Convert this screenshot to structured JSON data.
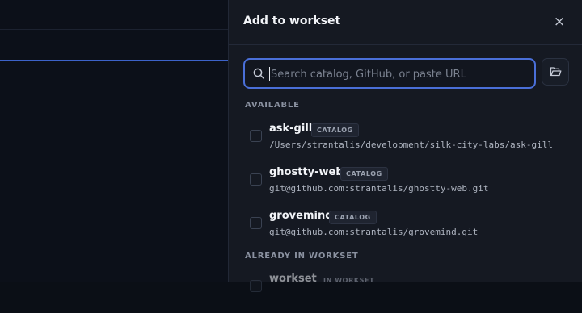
{
  "panel": {
    "title": "Add to workset",
    "close_label": "×"
  },
  "search": {
    "placeholder": "Search catalog, GitHub, or paste URL",
    "value": ""
  },
  "sections": {
    "available": "AVAILABLE",
    "already": "ALREADY IN WORKSET"
  },
  "available_items": [
    {
      "name": "ask-gill",
      "badge": "CATALOG",
      "path": "/Users/strantalis/development/silk-city-labs/ask-gill"
    },
    {
      "name": "ghostty-web",
      "badge": "CATALOG",
      "path": "git@github.com:strantalis/ghostty-web.git"
    },
    {
      "name": "grovemind",
      "badge": "CATALOG",
      "path": "git@github.com:strantalis/grovemind.git"
    }
  ],
  "workset_items": [
    {
      "name": "workset",
      "badge": "IN WORKSET"
    }
  ],
  "colors": {
    "accent": "#4a6fd8",
    "panel_bg": "#151922",
    "background": "#0b0f16"
  },
  "icons": {
    "search": "search-icon",
    "folder": "folder-open-icon",
    "close": "close-icon"
  }
}
